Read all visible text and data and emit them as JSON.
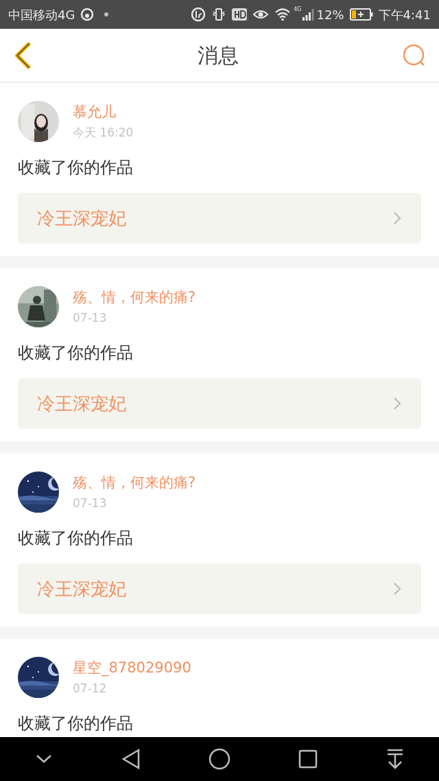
{
  "status_bar": {
    "carrier": "中国移动4G",
    "network": "4G",
    "battery": "12%",
    "time": "下午4:41"
  },
  "header": {
    "title": "消息"
  },
  "messages": [
    {
      "name": "慕允儿",
      "time": "今天 16:20",
      "action": "收藏了你的作品",
      "work": "冷王深宠妃"
    },
    {
      "name": "殇、情，何来的痛?",
      "time": "07-13",
      "action": "收藏了你的作品",
      "work": "冷王深宠妃"
    },
    {
      "name": "殇、情，何来的痛?",
      "time": "07-13",
      "action": "收藏了你的作品",
      "work": "冷王深宠妃"
    },
    {
      "name": "星空_878029090",
      "time": "07-12",
      "action": "收藏了你的作品"
    }
  ]
}
